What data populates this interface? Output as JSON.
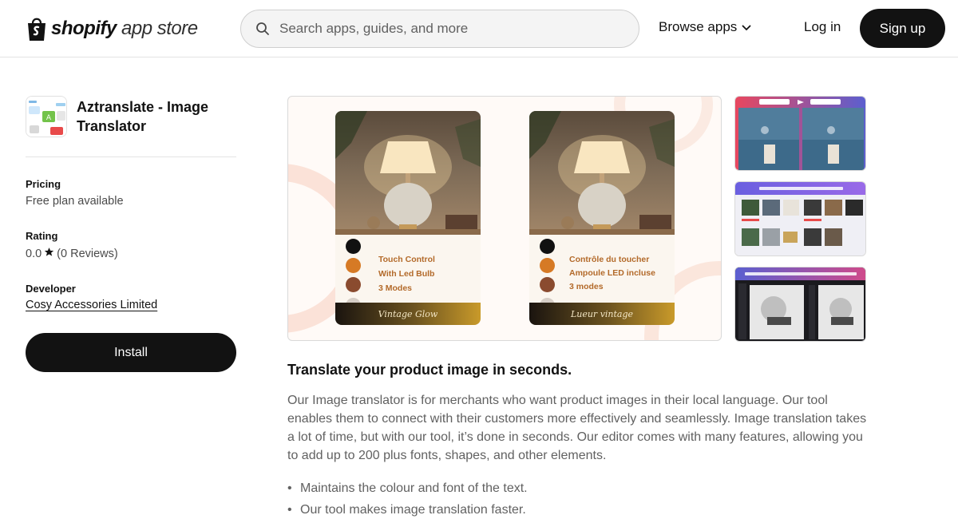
{
  "header": {
    "logo_brand": "shopify",
    "logo_suffix": "app store",
    "search_placeholder": "Search apps, guides, and more",
    "browse_label": "Browse apps",
    "login_label": "Log in",
    "signup_label": "Sign up"
  },
  "app": {
    "name": "Aztranslate - Image Translator",
    "pricing_label": "Pricing",
    "pricing_value": "Free plan available",
    "rating_label": "Rating",
    "rating_score": "0.0",
    "rating_reviews": "(0 Reviews)",
    "developer_label": "Developer",
    "developer_name": "Cosy Accessories Limited",
    "install_label": "Install"
  },
  "gallery": {
    "card_en": {
      "features": [
        "Touch Control",
        "With Led Bulb",
        "3 Modes"
      ],
      "band": "Vintage Glow"
    },
    "card_fr": {
      "features": [
        "Contrôle du toucher",
        "Ampoule LED incluse",
        "3 modes"
      ],
      "band": "Lueur vintage"
    },
    "swatch_colors": [
      "#111111",
      "#d67a25",
      "#8a4b2f",
      "#d6cec6"
    ]
  },
  "content": {
    "headline": "Translate your product image in seconds.",
    "description": "Our Image translator is for merchants who want product images in their local language. Our tool enables them to connect with their customers more effectively and seamlessly. Image translation takes a lot of time, but with our tool, it’s done in seconds. Our editor comes with many features, allowing you to add up to 200 plus fonts, shapes, and other elements.",
    "bullets": [
      "Maintains the colour and font of the text.",
      "Our tool makes image translation faster."
    ]
  },
  "colors": {
    "primary": "#121212",
    "muted_text": "#616161",
    "border": "#e3e3e3"
  }
}
